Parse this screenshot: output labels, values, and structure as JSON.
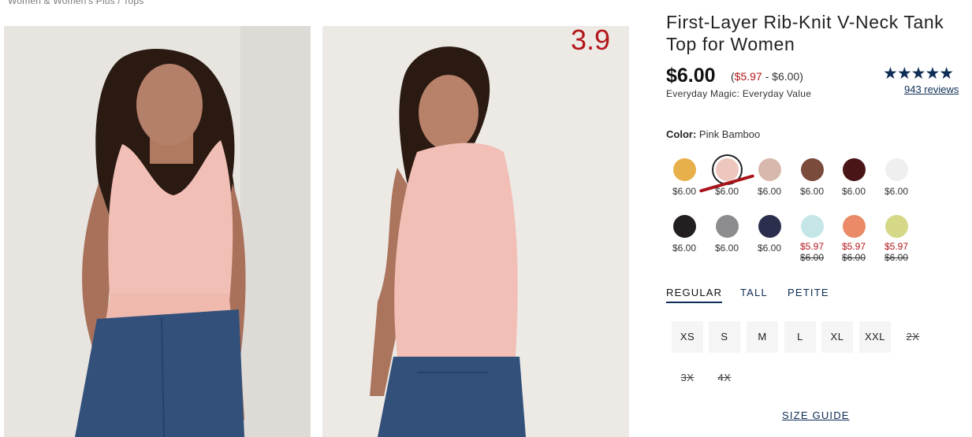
{
  "breadcrumb": "Women & Women's Plus / Tops",
  "overlay_number": "3.9",
  "product": {
    "title": "First-Layer Rib-Knit V-Neck Tank Top for Women",
    "price": "$6.00",
    "range_open": "(",
    "range_sale": "$5.97",
    "range_rest": " - $6.00)",
    "promo": "Everyday Magic: Everyday Value",
    "rating": 4.5,
    "stars": "★★★★★",
    "reviews": "943 reviews"
  },
  "color": {
    "label": "Color:",
    "value": "Pink Bamboo",
    "swatches": [
      {
        "color": "#e8b04a",
        "price": "$6.00"
      },
      {
        "color": "#edc7bd",
        "price": "$6.00",
        "selected": true
      },
      {
        "color": "#d7b8ac",
        "price": "$6.00"
      },
      {
        "color": "#7a4a3b",
        "price": "$6.00"
      },
      {
        "color": "#4a1516",
        "price": "$6.00"
      },
      {
        "color": "#efefef",
        "price": "$6.00"
      },
      {
        "color": "#231f20",
        "price": "$6.00"
      },
      {
        "color": "#8d8d90",
        "price": "$6.00"
      },
      {
        "color": "#2b2f4d",
        "price": "$6.00"
      },
      {
        "color": "#c4e6e6",
        "sale": "$5.97",
        "old": "$6.00"
      },
      {
        "color": "#ea8a66",
        "sale": "$5.97",
        "old": "$6.00"
      },
      {
        "color": "#d4d887",
        "sale": "$5.97",
        "old": "$6.00"
      }
    ]
  },
  "fit_tabs": [
    "REGULAR",
    "TALL",
    "PETITE"
  ],
  "sizes": [
    {
      "label": "XS",
      "available": true
    },
    {
      "label": "S",
      "available": true
    },
    {
      "label": "M",
      "available": true
    },
    {
      "label": "L",
      "available": true
    },
    {
      "label": "XL",
      "available": true
    },
    {
      "label": "XXL",
      "available": true
    },
    {
      "label": "2X",
      "available": false
    },
    {
      "label": "3X",
      "available": false
    },
    {
      "label": "4X",
      "available": false
    }
  ],
  "size_guide": "SIZE GUIDE"
}
